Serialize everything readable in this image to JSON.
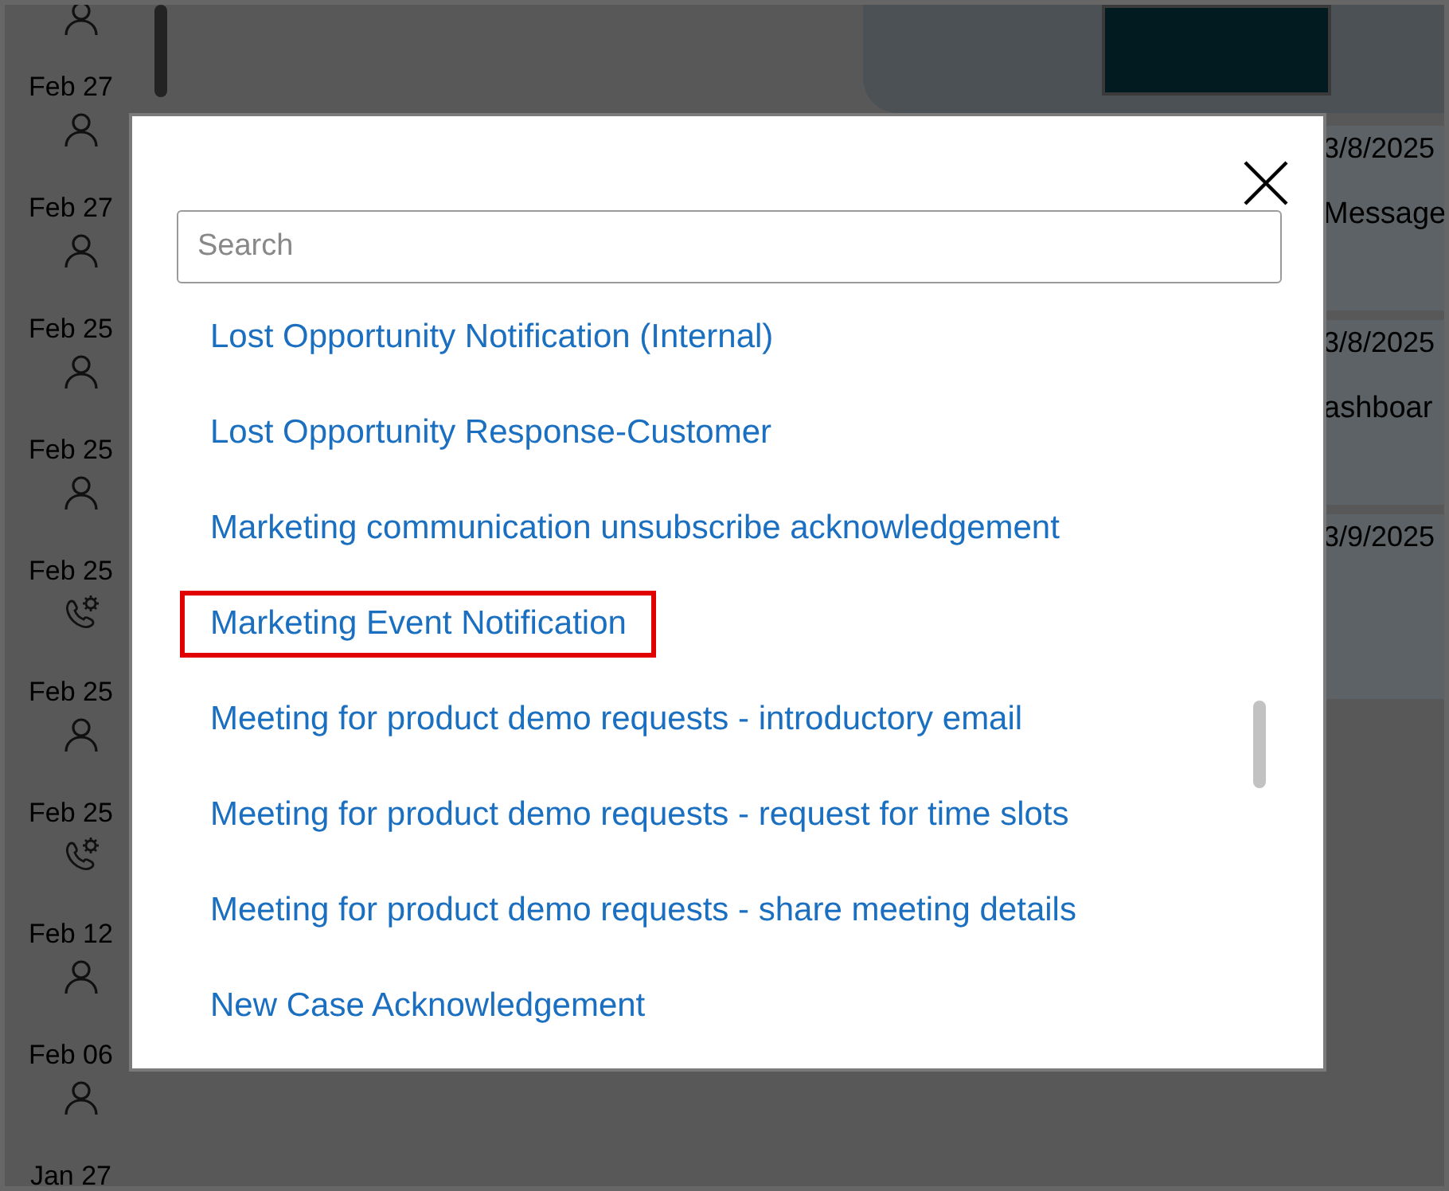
{
  "timeline": [
    {
      "kind": "person"
    },
    {
      "date": "Feb 27",
      "kind": "person"
    },
    {
      "date": "Feb 27",
      "kind": "person"
    },
    {
      "date": "Feb 25",
      "kind": "person"
    },
    {
      "date": "Feb 25",
      "kind": "person"
    },
    {
      "date": "Feb 25",
      "kind": "phone"
    },
    {
      "date": "Feb 25",
      "kind": "person"
    },
    {
      "date": "Feb 25",
      "kind": "phone"
    },
    {
      "date": "Feb 12",
      "kind": "person"
    },
    {
      "date": "Feb 06",
      "kind": "person"
    },
    {
      "date": "Jan 27"
    }
  ],
  "records": [
    {
      "date": "3/8/2025",
      "title": "Message"
    },
    {
      "date": "3/8/2025",
      "title": "ashboar"
    },
    {
      "date": "3/9/2025"
    }
  ],
  "dialog": {
    "search": {
      "placeholder": "Search"
    },
    "items": [
      {
        "label": "Lost Opportunity Notification (Internal)",
        "highlighted": false
      },
      {
        "label": "Lost Opportunity Response-Customer",
        "highlighted": false
      },
      {
        "label": "Marketing communication unsubscribe acknowledgement",
        "highlighted": false
      },
      {
        "label": "Marketing Event Notification",
        "highlighted": true
      },
      {
        "label": "Meeting for product demo requests - introductory email",
        "highlighted": false
      },
      {
        "label": "Meeting for product demo requests - request for time slots",
        "highlighted": false
      },
      {
        "label": "Meeting for product demo requests - share meeting details",
        "highlighted": false
      },
      {
        "label": "New Case Acknowledgement",
        "highlighted": false
      }
    ]
  }
}
